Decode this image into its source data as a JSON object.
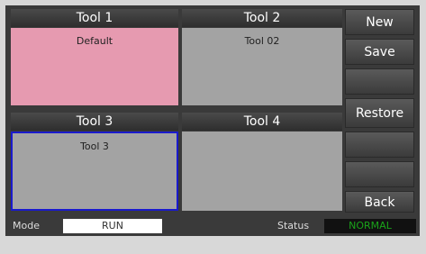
{
  "tools": [
    {
      "header": "Tool 1",
      "name": "Default",
      "color": "#e69ab0",
      "selected": false
    },
    {
      "header": "Tool 2",
      "name": "Tool 02",
      "color": "#a3a3a3",
      "selected": false
    },
    {
      "header": "Tool 3",
      "name": "Tool 3",
      "color": "#a3a3a3",
      "selected": true
    },
    {
      "header": "Tool 4",
      "name": "",
      "color": "#a3a3a3",
      "selected": false
    }
  ],
  "side_buttons": {
    "new": "New",
    "save": "Save",
    "restore": "Restore",
    "back": "Back"
  },
  "statusbar": {
    "mode_label": "Mode",
    "mode_value": "RUN",
    "status_label": "Status",
    "status_value": "NORMAL"
  },
  "colors": {
    "selection_border": "#1a1acc",
    "status_ok": "#1aa31a"
  }
}
